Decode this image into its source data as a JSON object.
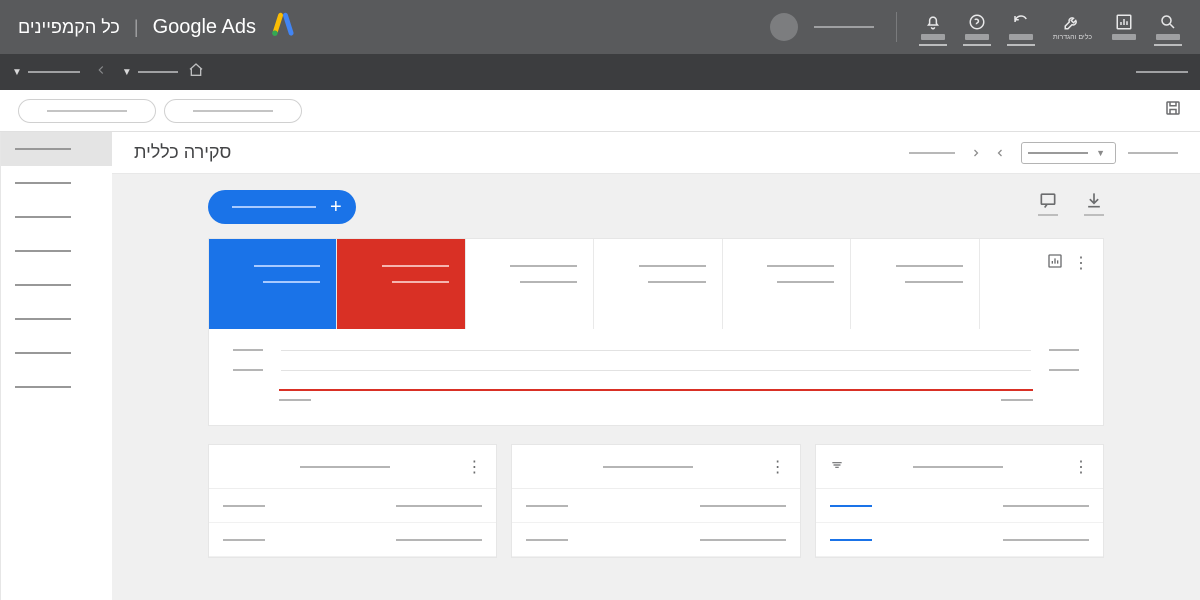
{
  "header": {
    "product": "Google Ads",
    "scope": "כל הקמפיינים",
    "tools_label": "כלים והגדרות"
  },
  "page": {
    "title": "סקירה כללית"
  },
  "colors": {
    "blue": "#1a73e8",
    "red": "#d93025"
  },
  "sidebar": {
    "items": [
      "",
      "",
      "",
      "",
      "",
      "",
      "",
      ""
    ]
  },
  "metrics": {
    "tiles": [
      "",
      "",
      "",
      "",
      "",
      ""
    ]
  },
  "summary_cards": {
    "items": [
      "",
      "",
      ""
    ]
  }
}
